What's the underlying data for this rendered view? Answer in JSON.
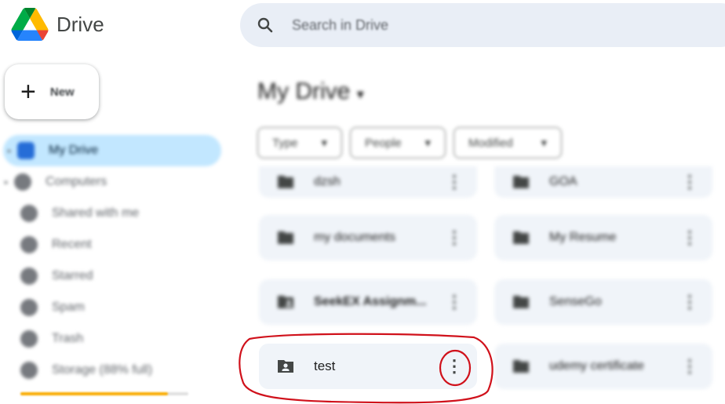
{
  "header": {
    "app_name": "Drive",
    "search_placeholder": "Search in Drive"
  },
  "sidebar": {
    "new_label": "New",
    "items": [
      {
        "label": "My Drive",
        "icon": "my-drive-icon",
        "active": true
      },
      {
        "label": "Computers",
        "icon": "computers-icon"
      },
      {
        "label": "Shared with me",
        "icon": "shared-with-me-icon"
      },
      {
        "label": "Recent",
        "icon": "recent-icon"
      },
      {
        "label": "Starred",
        "icon": "starred-icon"
      },
      {
        "label": "Spam",
        "icon": "spam-icon"
      },
      {
        "label": "Trash",
        "icon": "trash-icon"
      },
      {
        "label": "Storage (88% full)",
        "icon": "cloud-icon"
      }
    ],
    "storage_used_fraction": 0.88
  },
  "main": {
    "title": "My Drive",
    "title_caret": "▾",
    "filters": [
      {
        "label": "Type",
        "caret": "▾"
      },
      {
        "label": "People",
        "caret": "▾"
      },
      {
        "label": "Modified",
        "caret": "▾"
      }
    ],
    "folders": [
      {
        "name": "dzsh"
      },
      {
        "name": "GOA"
      },
      {
        "name": "my documents"
      },
      {
        "name": "My Resume"
      },
      {
        "name": "SeekEX Assignm..."
      },
      {
        "name": "SenseGo"
      },
      {
        "name": "test"
      },
      {
        "name": "udemy certificate"
      }
    ],
    "menu_glyph": "⋮"
  },
  "colors": {
    "active_nav_bg": "#c2e7ff",
    "card_bg": "#f0f4f9",
    "search_bg": "#e9eef6",
    "annotation": "#d0111b",
    "storage_bar": "#f9ab00"
  }
}
